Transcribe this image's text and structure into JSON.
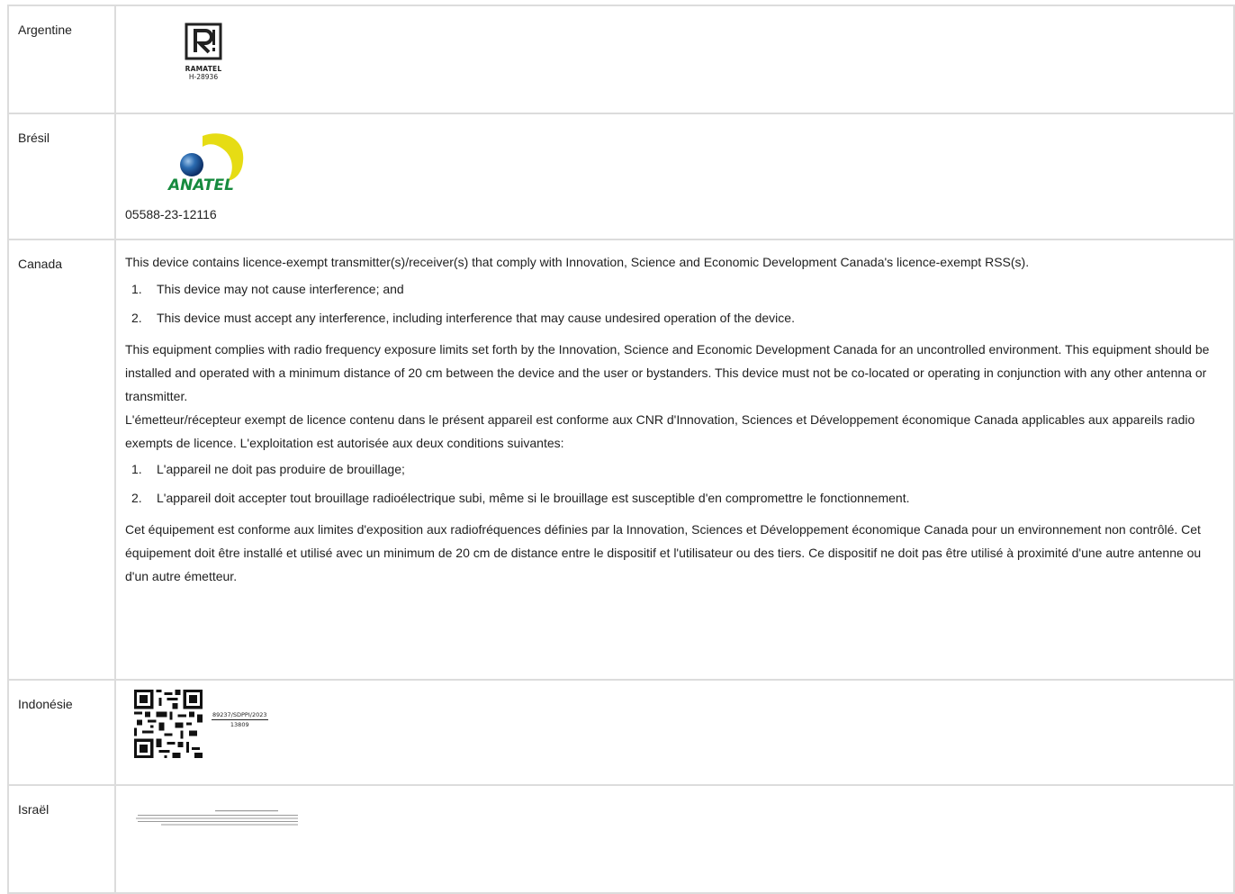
{
  "rows": {
    "argentina": {
      "country": "Argentine",
      "mark_name": "RAMATEL",
      "mark_code": "H-28936"
    },
    "brazil": {
      "country": "Brésil",
      "mark_name": "ANATEL",
      "number": "05588-23-12116"
    },
    "canada": {
      "country": "Canada",
      "en_intro": "This device contains licence-exempt transmitter(s)/receiver(s) that comply with Innovation, Science and Economic Development Canada's licence-exempt RSS(s).",
      "en_conditions": [
        {
          "num": "1.",
          "text": "This device may not cause interference; and"
        },
        {
          "num": "2.",
          "text": "This device must accept any interference, including interference that may cause undesired operation of the device."
        }
      ],
      "en_exposure": "This equipment complies with radio frequency exposure limits set forth by the Innovation, Science and Economic Development Canada for an uncontrolled environment. This equipment should be installed and operated with a minimum distance of 20 cm between the device and the user or bystanders. This device must not be co-located or operating in conjunction with any other antenna or transmitter.",
      "fr_intro": "L'émetteur/récepteur exempt de licence contenu dans le présent appareil est conforme aux CNR d'Innovation, Sciences et Développement économique Canada applicables aux appareils radio exempts de licence. L'exploitation est autorisée aux deux conditions suivantes:",
      "fr_conditions": [
        {
          "num": "1.",
          "text": "L'appareil ne doit pas produire de brouillage;"
        },
        {
          "num": "2.",
          "text": "L'appareil doit accepter tout brouillage radioélectrique subi, même si le brouillage est susceptible d'en compromettre le fonctionnement."
        }
      ],
      "fr_exposure": "Cet équipement est conforme aux limites d'exposition aux radiofréquences définies par la Innovation, Sciences et Développement économique Canada pour un environnement non contrôlé. Cet équipement doit être installé et utilisé avec un minimum de 20 cm de distance entre le dispositif et l'utilisateur ou des tiers. Ce dispositif ne doit pas être utilisé à proximité d'une autre antenne ou d'un autre émetteur."
    },
    "indonesia": {
      "country": "Indonésie",
      "cert_top": "89237/SDPPI/2023",
      "cert_bottom": "13809"
    },
    "israel": {
      "country": "Israël"
    }
  },
  "colors": {
    "border": "#dcdcdc",
    "text": "#1f1f1f",
    "anatel_yellow": "#e6dc14",
    "anatel_blue": "#1e5a9c",
    "anatel_green": "#168a3e"
  },
  "icons": {
    "argentina": "ramatel-logo",
    "brazil": "anatel-logo",
    "indonesia": "qr-code",
    "israel": "hebrew-notice-image"
  }
}
